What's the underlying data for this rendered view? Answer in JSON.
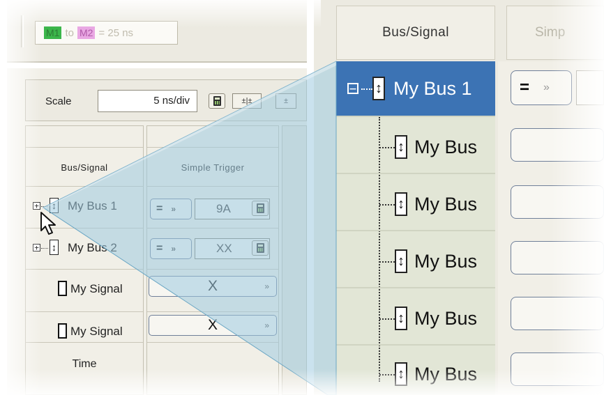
{
  "toolbar": {
    "marker_from": "M1",
    "marker_connector": "to",
    "marker_to": "M2",
    "marker_delta": "= 25 ns"
  },
  "scale": {
    "label": "Scale",
    "value": "5 ns/div",
    "zoom_in_label": "±|±",
    "zoom_out_label": "±"
  },
  "table": {
    "header_bus_signal": "Bus/Signal",
    "header_simple_trigger": "Simple Trigger",
    "rows": [
      {
        "name": "My Bus 1",
        "type": "bus",
        "operator": "=",
        "value": "9A"
      },
      {
        "name": "My Bus 2",
        "type": "bus",
        "operator": "=",
        "value": "XX"
      },
      {
        "name": "My Signal",
        "type": "signal",
        "value": "X"
      },
      {
        "name": "My Signal",
        "type": "signal",
        "value": "X"
      }
    ],
    "time_label": "Time"
  },
  "zoom": {
    "header_bus_signal": "Bus/Signal",
    "header_simple_trigger_partial": "Simp",
    "selected_bus": "My Bus 1",
    "children": [
      "My Bus",
      "My Bus",
      "My Bus",
      "My Bus",
      "My Bus"
    ],
    "operator": "="
  },
  "colors": {
    "selection": "#3c73b4",
    "marker_m1": "#3bb64a",
    "marker_m2": "#e9a8e3",
    "beam": "#9fcbe0"
  }
}
